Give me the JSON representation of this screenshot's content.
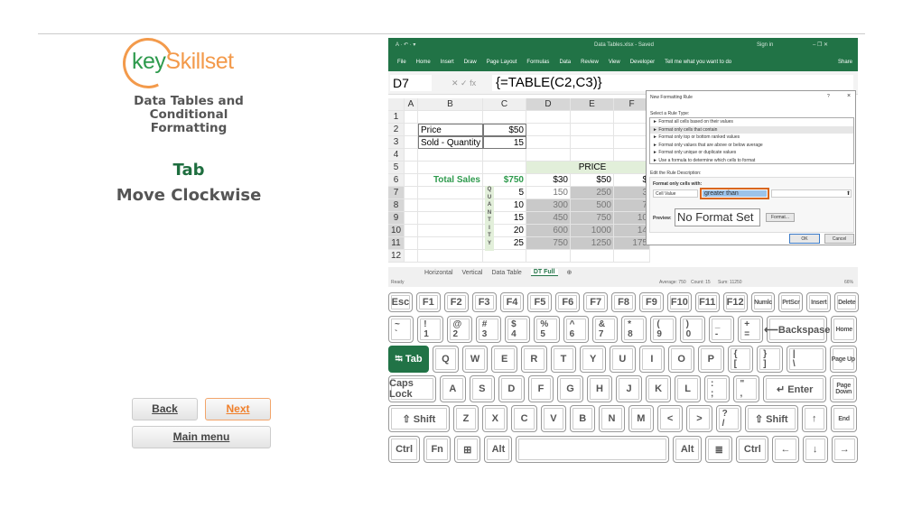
{
  "logo": {
    "key": "key",
    "skillset": "Skillset"
  },
  "lesson_title": [
    "Data Tables and",
    "Conditional",
    "Formatting"
  ],
  "shortcut": {
    "key": "Tab",
    "action": "Move Clockwise"
  },
  "nav": {
    "back": "Back",
    "next": "Next",
    "main_menu": "Main menu"
  },
  "colors": {
    "excel_green": "#217346",
    "accent_orange": "#f07f2a",
    "logo_green": "#2e9a4d"
  },
  "excel": {
    "title": "Data Tables.xlsx - Saved",
    "sign_in": "Sign in",
    "share": "Share",
    "ribbon_tabs": [
      "File",
      "Home",
      "Insert",
      "Draw",
      "Page Layout",
      "Formulas",
      "Data",
      "Review",
      "View",
      "Developer"
    ],
    "tell_me": "Tell me what you want to do",
    "name_box": "D7",
    "formula": "{=TABLE(C2,C3)}",
    "columns": [
      "A",
      "B",
      "C",
      "D",
      "E",
      "F"
    ],
    "rows": [
      "1",
      "2",
      "3",
      "4",
      "5",
      "6",
      "7",
      "8",
      "9",
      "10",
      "11",
      "12"
    ],
    "cells": {
      "B2": "Price",
      "C2": "$50",
      "B3": "Sold - Quantity",
      "C3": "15",
      "E5": "PRICE",
      "B6": "Total Sales",
      "C6": "$750",
      "D6": "$30",
      "E6": "$50",
      "F6": "$",
      "C7": "5",
      "C8": "10",
      "C9": "15",
      "C10": "20",
      "C11": "25",
      "D7": "150",
      "E7": "250",
      "F7": "3",
      "D8": "300",
      "E8": "500",
      "F8": "7",
      "D9": "450",
      "E9": "750",
      "F9": "10",
      "D10": "600",
      "E10": "1000",
      "F10": "14",
      "D11": "750",
      "E11": "1250",
      "F11": "175"
    },
    "quantity_label": [
      "Q",
      "U",
      "A",
      "N",
      "T",
      "I",
      "T",
      "Y"
    ],
    "sheet_tabs": [
      "Horizontal",
      "Vertical",
      "Data Table",
      "DT Full"
    ],
    "active_sheet": "DT Full",
    "status": {
      "ready": "Ready",
      "average": "Average: 750",
      "count": "Count: 15",
      "sum": "Sum: 11250",
      "zoom": "66%"
    },
    "dialog": {
      "title": "New Formatting Rule",
      "help": "?",
      "close": "×",
      "select_label": "Select a Rule Type:",
      "rule_types": [
        "► Format all cells based on their values",
        "► Format only cells that contain",
        "► Format only top or bottom ranked values",
        "► Format only values that are above or below average",
        "► Format only unique or duplicate values",
        "► Use a formula to determine which cells to format"
      ],
      "selected_rule": 1,
      "edit_label": "Edit the Rule Description:",
      "format_only": "Format only cells with:",
      "cell_value": "Cell Value",
      "operator": "greater than",
      "preview_label": "Preview:",
      "preview": "No Format Set",
      "format_btn": "Format...",
      "ok": "OK",
      "cancel": "Cancel"
    }
  },
  "keyboard": [
    [
      {
        "l": "Esc"
      },
      {
        "l": "F1"
      },
      {
        "l": "F2"
      },
      {
        "l": "F3"
      },
      {
        "l": "F4"
      },
      {
        "l": "F5"
      },
      {
        "l": "F6"
      },
      {
        "l": "F7"
      },
      {
        "l": "F8"
      },
      {
        "l": "F9"
      },
      {
        "l": "F10"
      },
      {
        "l": "F11"
      },
      {
        "l": "F12"
      },
      {
        "l": "Numlc"
      },
      {
        "l": "PrtScr"
      },
      {
        "l": "Insert"
      },
      {
        "l": "Delete"
      }
    ],
    [
      {
        "t": "~",
        "b": "`"
      },
      {
        "t": "!",
        "b": "1"
      },
      {
        "t": "@",
        "b": "2"
      },
      {
        "t": "#",
        "b": "3"
      },
      {
        "t": "$",
        "b": "4"
      },
      {
        "t": "%",
        "b": "5"
      },
      {
        "t": "^",
        "b": "6"
      },
      {
        "t": "&",
        "b": "7"
      },
      {
        "t": "*",
        "b": "8"
      },
      {
        "t": "(",
        "b": "9"
      },
      {
        "t": ")",
        "b": "0"
      },
      {
        "t": "_",
        "b": "-"
      },
      {
        "t": "+",
        "b": "="
      },
      {
        "l": "⟵Backspase"
      },
      {
        "l": "Home"
      }
    ],
    [
      {
        "l": "⭾ Tab",
        "active": true
      },
      {
        "l": "Q"
      },
      {
        "l": "W"
      },
      {
        "l": "E"
      },
      {
        "l": "R"
      },
      {
        "l": "T"
      },
      {
        "l": "Y"
      },
      {
        "l": "U"
      },
      {
        "l": "I"
      },
      {
        "l": "O"
      },
      {
        "l": "P"
      },
      {
        "t": "{",
        "b": "["
      },
      {
        "t": "}",
        "b": "]"
      },
      {
        "t": "|",
        "b": "\\"
      },
      {
        "l": "Page Up"
      }
    ],
    [
      {
        "l": "Caps Lock"
      },
      {
        "l": "A"
      },
      {
        "l": "S"
      },
      {
        "l": "D"
      },
      {
        "l": "F"
      },
      {
        "l": "G"
      },
      {
        "l": "H"
      },
      {
        "l": "J"
      },
      {
        "l": "K"
      },
      {
        "l": "L"
      },
      {
        "t": ":",
        "b": ";"
      },
      {
        "t": "\"",
        "b": ","
      },
      {
        "l": "↵ Enter"
      },
      {
        "l": "Page Down"
      }
    ],
    [
      {
        "l": "⇧ Shift"
      },
      {
        "l": "Z"
      },
      {
        "l": "X"
      },
      {
        "l": "C"
      },
      {
        "l": "V"
      },
      {
        "l": "B"
      },
      {
        "l": "N"
      },
      {
        "l": "M"
      },
      {
        "l": "<"
      },
      {
        "l": ">"
      },
      {
        "t": "?",
        "b": "/"
      },
      {
        "l": "⇧ Shift"
      },
      {
        "l": "↑"
      },
      {
        "l": "End"
      }
    ],
    [
      {
        "l": "Ctrl"
      },
      {
        "l": "Fn"
      },
      {
        "l": "⊞"
      },
      {
        "l": "Alt"
      },
      {
        "l": ""
      },
      {
        "l": "Alt"
      },
      {
        "l": "≣"
      },
      {
        "l": "Ctrl"
      },
      {
        "l": "←"
      },
      {
        "l": "↓"
      },
      {
        "l": "→"
      }
    ]
  ]
}
